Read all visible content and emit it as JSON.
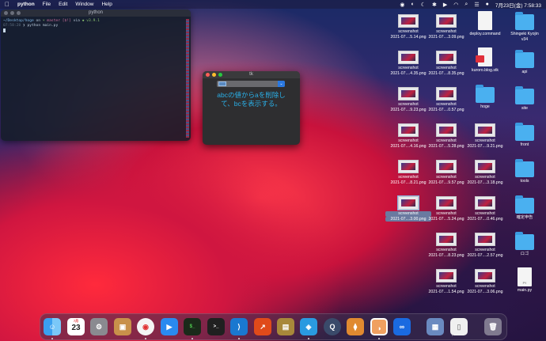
{
  "menubar": {
    "app_name": "python",
    "items": [
      "File",
      "Edit",
      "Window",
      "Help"
    ],
    "date_time": "7月23日(金) 7:58:33"
  },
  "terminal": {
    "title": "python",
    "prompt_path": "~/Desktop/hoge",
    "prompt_on": "on",
    "prompt_branch": "master [$!]",
    "prompt_via": "via",
    "prompt_version": "v3.9.1",
    "time": "07:58:28",
    "command": "python main.py"
  },
  "tk": {
    "title": "tk",
    "label_line1": "abcの値からaを削除し",
    "label_line2": "て、bcを表示する。"
  },
  "desktop": {
    "col1": [
      {
        "l1": "screenshot",
        "l2": "2021-07....5.14.png"
      },
      {
        "l1": "screenshot",
        "l2": "2021-07....4.35.png"
      },
      {
        "l1": "screenshot",
        "l2": "2021-07....9.23.png"
      },
      {
        "l1": "screenshot",
        "l2": "2021-07....4.16.png"
      },
      {
        "l1": "screenshot",
        "l2": "2021-07....8.21.png"
      },
      {
        "l1": "screenshot",
        "l2": "2021-07....3.00.png"
      }
    ],
    "col2": [
      {
        "l1": "screenshot",
        "l2": "2021-07....3.09.png"
      },
      {
        "l1": "screenshot",
        "l2": "2021-07....8.35.png"
      },
      {
        "l1": "screenshot",
        "l2": "2021-07....0.57.png"
      },
      {
        "l1": "screenshot",
        "l2": "2021-07....5.28.png"
      },
      {
        "l1": "screenshot",
        "l2": "2021-07....9.57.png"
      },
      {
        "l1": "screenshot",
        "l2": "2021-07....5.24.png"
      },
      {
        "l1": "screenshot",
        "l2": "2021-07....8.23.png"
      },
      {
        "l1": "screenshot",
        "l2": "2021-07....1.54.png"
      }
    ],
    "col3": [
      {
        "type": "doc",
        "l1": "deploy.command",
        "l2": ""
      },
      {
        "type": "docred",
        "l1": "kuroro.blog.stk",
        "l2": ""
      },
      {
        "type": "folder",
        "l1": "hoge",
        "l2": ""
      },
      {
        "type": "shot",
        "l1": "screenshot",
        "l2": "2021-07....9.21.png"
      },
      {
        "type": "shot",
        "l1": "screenshot",
        "l2": "2021-07....3.18.png"
      },
      {
        "type": "shot",
        "l1": "screenshot",
        "l2": "2021-07....0.46.png"
      },
      {
        "type": "shot",
        "l1": "screenshot",
        "l2": "2021-07....2.57.png"
      },
      {
        "type": "shot",
        "l1": "screenshot",
        "l2": "2021-07....3.06.png"
      }
    ],
    "col4": [
      {
        "type": "folder",
        "l1": "Shingeki Kyojin",
        "l2": "v34"
      },
      {
        "type": "folder",
        "l1": "api",
        "l2": ""
      },
      {
        "type": "folder",
        "l1": "site",
        "l2": ""
      },
      {
        "type": "folder",
        "l1": "front",
        "l2": ""
      },
      {
        "type": "folder",
        "l1": "tools",
        "l2": ""
      },
      {
        "type": "folder",
        "l1": "確定申告",
        "l2": ""
      },
      {
        "type": "folder",
        "l1": "ロゴ",
        "l2": ""
      },
      {
        "type": "py",
        "l1": "main.py",
        "l2": ""
      }
    ]
  },
  "dock": {
    "calendar_month": "7月",
    "calendar_day": "23",
    "apps": [
      "finder-icon",
      "calendar-icon",
      "system-preferences-icon",
      "contacts-icon",
      "chrome-icon",
      "zoom-icon",
      "terminal-icon",
      "terminal2-icon",
      "vscode-icon",
      "activity-icon",
      "archive-icon",
      "docker-icon",
      "quicktime-icon",
      "sourcetree-icon",
      "dbeaver-icon",
      "infinity-icon",
      "preview-icon",
      "document-icon",
      "trash-icon"
    ]
  },
  "colors": {
    "accent_blue": "#2ab0e8",
    "folder_blue": "#4ab0f0",
    "close_red": "#ff5f57",
    "minimize_yellow": "#febc2e",
    "zoom_green": "#28c840"
  }
}
